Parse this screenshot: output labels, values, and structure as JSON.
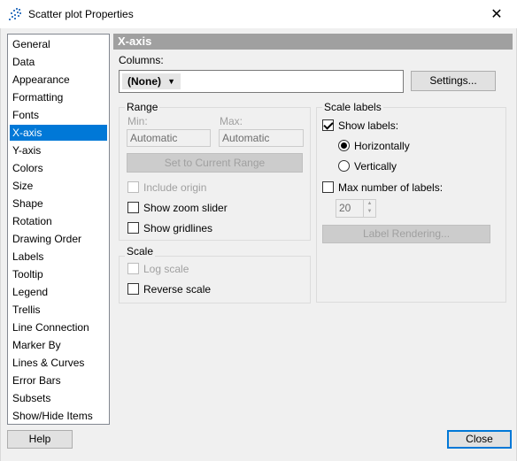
{
  "window": {
    "title": "Scatter plot Properties",
    "close_glyph": "✕"
  },
  "sidebar": {
    "items": [
      {
        "label": "General"
      },
      {
        "label": "Data"
      },
      {
        "label": "Appearance"
      },
      {
        "label": "Formatting"
      },
      {
        "label": "Fonts"
      },
      {
        "label": "X-axis",
        "selected": true
      },
      {
        "label": "Y-axis"
      },
      {
        "label": "Colors"
      },
      {
        "label": "Size"
      },
      {
        "label": "Shape"
      },
      {
        "label": "Rotation"
      },
      {
        "label": "Drawing Order"
      },
      {
        "label": "Labels"
      },
      {
        "label": "Tooltip"
      },
      {
        "label": "Legend"
      },
      {
        "label": "Trellis"
      },
      {
        "label": "Line Connection"
      },
      {
        "label": "Marker By"
      },
      {
        "label": "Lines & Curves"
      },
      {
        "label": "Error Bars"
      },
      {
        "label": "Subsets"
      },
      {
        "label": "Show/Hide Items"
      }
    ]
  },
  "panel": {
    "header": "X-axis",
    "columns_label": "Columns:",
    "columns_value": "(None)",
    "settings_button": "Settings...",
    "range": {
      "title": "Range",
      "min_label": "Min:",
      "max_label": "Max:",
      "min_value": "Automatic",
      "max_value": "Automatic",
      "set_current_button": "Set to Current Range",
      "include_origin": "Include origin",
      "show_zoom_slider": "Show zoom slider",
      "show_gridlines": "Show gridlines"
    },
    "scale": {
      "title": "Scale",
      "log_scale": "Log scale",
      "reverse_scale": "Reverse scale"
    },
    "scale_labels": {
      "title": "Scale labels",
      "show_labels": "Show labels:",
      "show_labels_checked": true,
      "horizontally": "Horizontally",
      "vertically": "Vertically",
      "orientation_selected": "Horizontally",
      "max_number": "Max number of labels:",
      "max_number_value": "20",
      "label_rendering_button": "Label Rendering..."
    }
  },
  "footer": {
    "help_button": "Help",
    "close_button": "Close"
  },
  "colors": {
    "selection": "#0078d7",
    "header_bg": "#a0a0a0"
  }
}
